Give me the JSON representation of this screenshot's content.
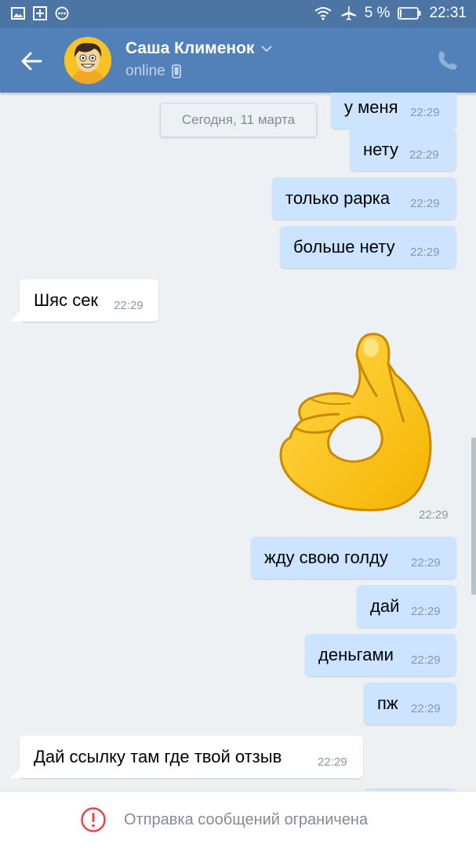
{
  "statusbar": {
    "battery": "5 %",
    "time": "22:31"
  },
  "header": {
    "name": "Саша Клименок",
    "status": "online"
  },
  "chat": {
    "date_separator": "Сегодня, 11 марта",
    "messages": [
      {
        "dir": "out",
        "text": "у меня",
        "time": "22:29"
      },
      {
        "dir": "out",
        "text": "нету",
        "time": "22:29"
      },
      {
        "dir": "out",
        "text": "только рарка",
        "time": "22:29"
      },
      {
        "dir": "out",
        "text": "больше нету",
        "time": "22:29"
      },
      {
        "dir": "in",
        "text": "Шяс сек",
        "time": "22:29"
      },
      {
        "dir": "out",
        "type": "sticker",
        "sticker": "ok-hand",
        "time": "22:29"
      },
      {
        "dir": "out",
        "text": "жду свою голду",
        "time": "22:29"
      },
      {
        "dir": "out",
        "text": "дай",
        "time": "22:29"
      },
      {
        "dir": "out",
        "text": "деньгами",
        "time": "22:29"
      },
      {
        "dir": "out",
        "text": "пж",
        "time": "22:29"
      },
      {
        "dir": "in",
        "text": "Дай ссылку там где твой отзыв",
        "time": "22:29"
      }
    ]
  },
  "footer": {
    "restricted_text": "Отправка сообщений ограничена"
  },
  "colors": {
    "header": "#5181b8",
    "statusbar": "#4c75a3",
    "outgoing_bubble": "#cce4ff",
    "incoming_bubble": "#ffffff",
    "background": "#edf1f4",
    "warning": "#e64646"
  }
}
